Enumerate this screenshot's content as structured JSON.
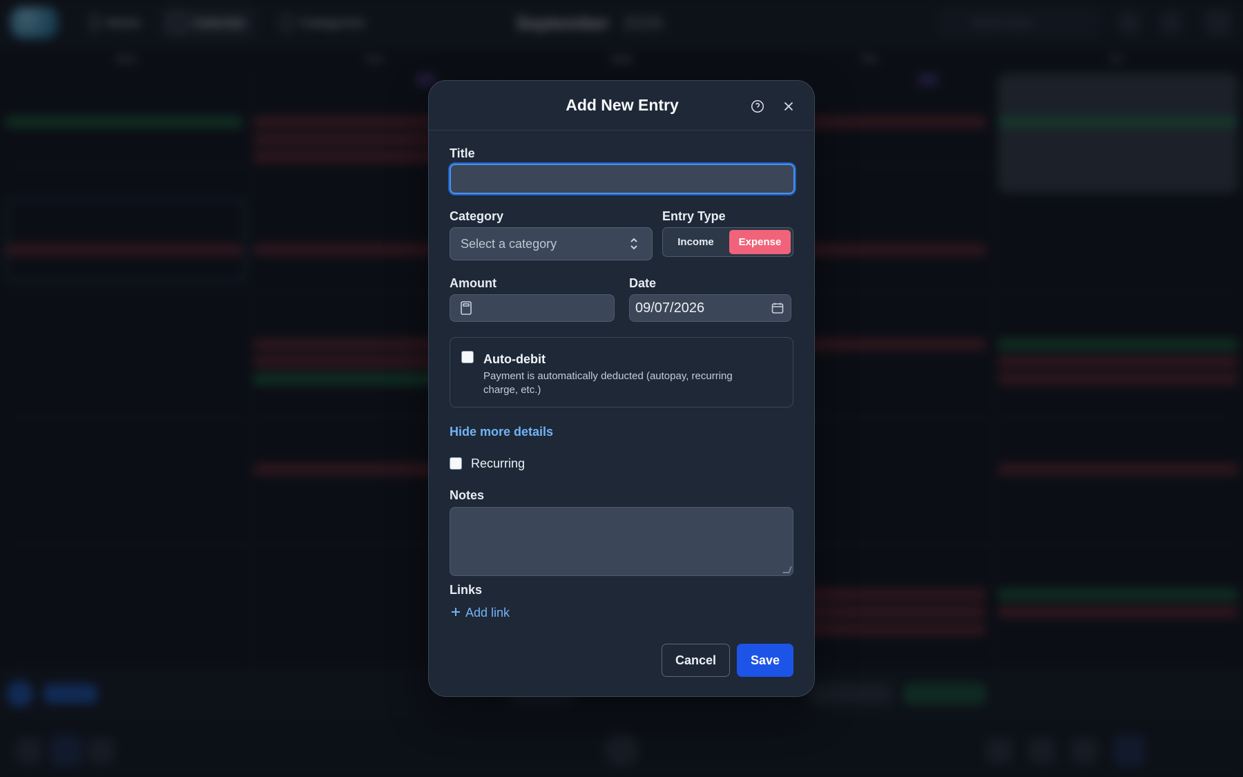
{
  "background": {
    "nav": [
      {
        "label": "Home"
      },
      {
        "label": "Calendar"
      },
      {
        "label": "Categories"
      }
    ],
    "month": "September",
    "year": "2026",
    "search_placeholder": "Search entry",
    "weekdays": [
      "Mon",
      "Tue",
      "Wed",
      "Thu",
      "Fri"
    ]
  },
  "modal": {
    "title": "Add New Entry",
    "icons": {
      "help": "question-circle-icon",
      "close": "close-icon",
      "select": "chevron-up-down-icon",
      "amount": "calculator-icon",
      "date": "calendar-icon",
      "add": "plus-icon"
    },
    "fields": {
      "title_label": "Title",
      "title_value": "",
      "category_label": "Category",
      "category_placeholder": "Select a category",
      "entry_type_label": "Entry Type",
      "entry_type_options": [
        "Income",
        "Expense"
      ],
      "entry_type_selected": "Expense",
      "amount_label": "Amount",
      "amount_value": "",
      "date_label": "Date",
      "date_value": "09/07/2026"
    },
    "auto_debit": {
      "title": "Auto-debit",
      "description": "Payment is automatically deducted (autopay, recurring charge, etc.)"
    },
    "details_link": "Hide more details",
    "recurring_label": "Recurring",
    "notes_label": "Notes",
    "links_label": "Links",
    "add_link_label": "Add link",
    "buttons": {
      "cancel": "Cancel",
      "save": "Save"
    },
    "colors": {
      "primary": "#1d54e8",
      "expense": "#f1637a",
      "focus": "#4f90e7",
      "link": "#72b3f5"
    }
  }
}
